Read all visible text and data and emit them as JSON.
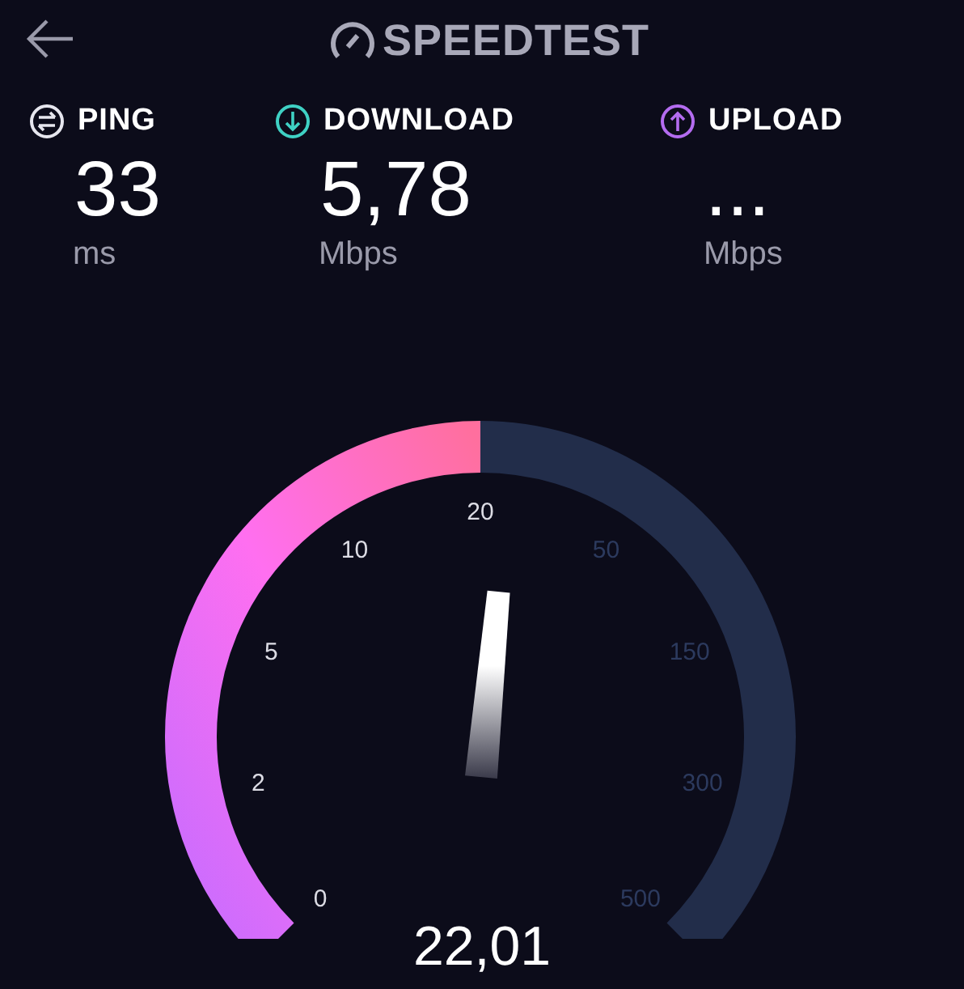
{
  "header": {
    "title": "SPEEDTEST"
  },
  "metrics": [
    {
      "kind": "ping",
      "label": "PING",
      "value": "33",
      "unit": "ms"
    },
    {
      "kind": "download",
      "label": "DOWNLOAD",
      "value": "5,78",
      "unit": "Mbps"
    },
    {
      "kind": "upload",
      "label": "UPLOAD",
      "value": "...",
      "unit": "Mbps"
    }
  ],
  "gauge": {
    "scale": [
      "0",
      "2",
      "5",
      "10",
      "20",
      "50",
      "150",
      "300",
      "500"
    ],
    "reading": "22,01"
  }
}
